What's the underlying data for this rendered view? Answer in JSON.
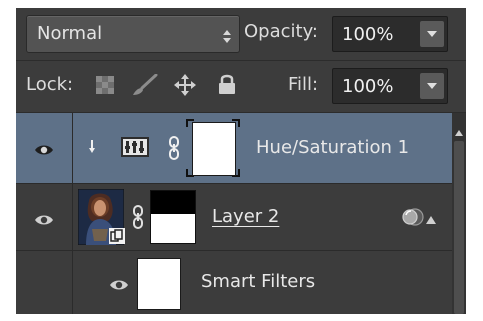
{
  "blend_mode": {
    "value": "Normal",
    "icon": "updown-arrows-icon"
  },
  "opacity": {
    "label": "Opacity:",
    "value": "100%"
  },
  "lock": {
    "label": "Lock:",
    "icons": [
      "lock-transparent-pixels-icon",
      "lock-image-pixels-icon",
      "lock-position-icon",
      "lock-all-icon"
    ]
  },
  "fill": {
    "label": "Fill:",
    "value": "100%"
  },
  "layers": [
    {
      "name": "Hue/Saturation 1",
      "type": "adjustment",
      "visible": true,
      "selected": true,
      "clipped": true
    },
    {
      "name": "Layer 2",
      "type": "smart-object",
      "visible": true,
      "selected": false,
      "underlined": true
    },
    {
      "name": "Smart Filters",
      "type": "smart-filters",
      "visible": true,
      "selected": false
    }
  ],
  "colors": {
    "panel_bg": "#3c3c3c",
    "selected_row": "#5e7188",
    "field_bg": "#2c2c2c"
  }
}
